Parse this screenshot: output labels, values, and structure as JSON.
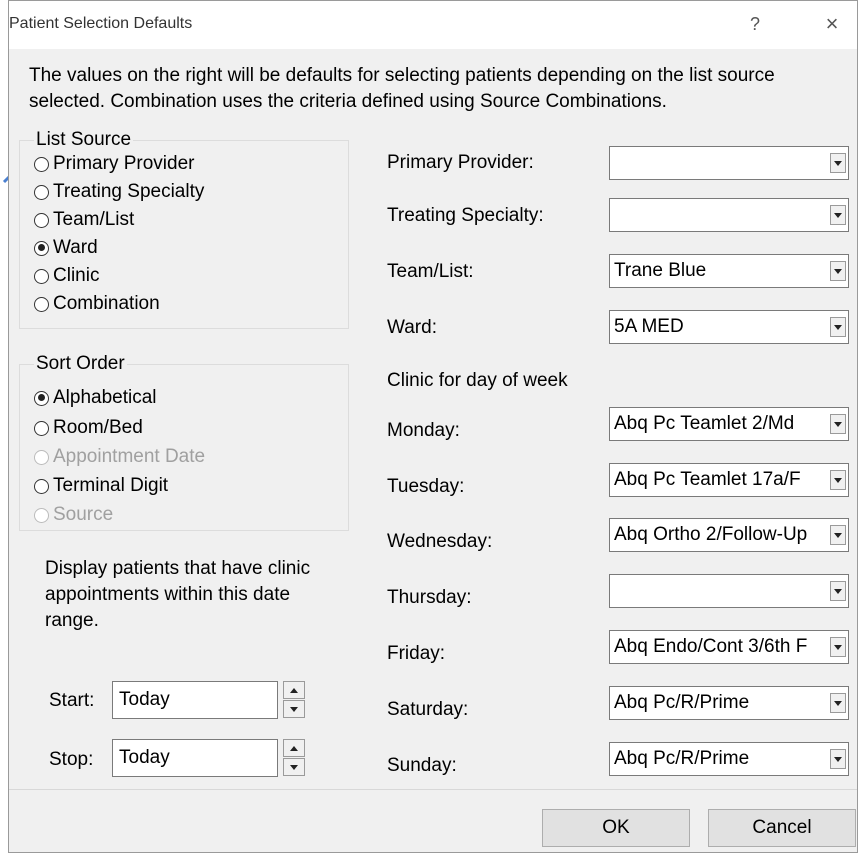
{
  "window": {
    "title": "Patient Selection Defaults",
    "help_label": "?",
    "close_label": "×"
  },
  "description": "The values on the right will be defaults for selecting patients depending on the list source selected. Combination uses the criteria defined using Source Combinations.",
  "list_source": {
    "legend": "List Source",
    "options": [
      {
        "label": "Primary Provider",
        "checked": false,
        "disabled": false
      },
      {
        "label": "Treating Specialty",
        "checked": false,
        "disabled": false
      },
      {
        "label": "Team/List",
        "checked": false,
        "disabled": false
      },
      {
        "label": "Ward",
        "checked": true,
        "disabled": false
      },
      {
        "label": "Clinic",
        "checked": false,
        "disabled": false
      },
      {
        "label": "Combination",
        "checked": false,
        "disabled": false
      }
    ]
  },
  "sort_order": {
    "legend": "Sort Order",
    "options": [
      {
        "label": "Alphabetical",
        "checked": true,
        "disabled": false
      },
      {
        "label": "Room/Bed",
        "checked": false,
        "disabled": false
      },
      {
        "label": "Appointment Date",
        "checked": false,
        "disabled": true
      },
      {
        "label": "Terminal Digit",
        "checked": false,
        "disabled": false
      },
      {
        "label": "Source",
        "checked": false,
        "disabled": true
      }
    ]
  },
  "date_range": {
    "text": "Display patients that have clinic appointments within this date range.",
    "start_label": "Start:",
    "start_value": "Today",
    "stop_label": "Stop:",
    "stop_value": "Today"
  },
  "defaults": {
    "primary_provider": {
      "label": "Primary Provider:",
      "value": ""
    },
    "treating_specialty": {
      "label": "Treating Specialty:",
      "value": ""
    },
    "team_list": {
      "label": "Team/List:",
      "value": "Trane Blue"
    },
    "ward": {
      "label": "Ward:",
      "value": "5A MED"
    },
    "clinic_heading": "Clinic for day of week",
    "monday": {
      "label": "Monday:",
      "value": "Abq Pc Teamlet 2/Md"
    },
    "tuesday": {
      "label": "Tuesday:",
      "value": "Abq Pc Teamlet 17a/F"
    },
    "wednesday": {
      "label": "Wednesday:",
      "value": "Abq Ortho 2/Follow-Up"
    },
    "thursday": {
      "label": "Thursday:",
      "value": ""
    },
    "friday": {
      "label": "Friday:",
      "value": "Abq Endo/Cont 3/6th F"
    },
    "saturday": {
      "label": "Saturday:",
      "value": "Abq Pc/R/Prime"
    },
    "sunday": {
      "label": "Sunday:",
      "value": "Abq Pc/R/Prime"
    }
  },
  "buttons": {
    "ok": "OK",
    "cancel": "Cancel"
  },
  "colors": {
    "dialog_bg": "#f0f0f0",
    "annotation_arrow": "#4a7fd0"
  }
}
